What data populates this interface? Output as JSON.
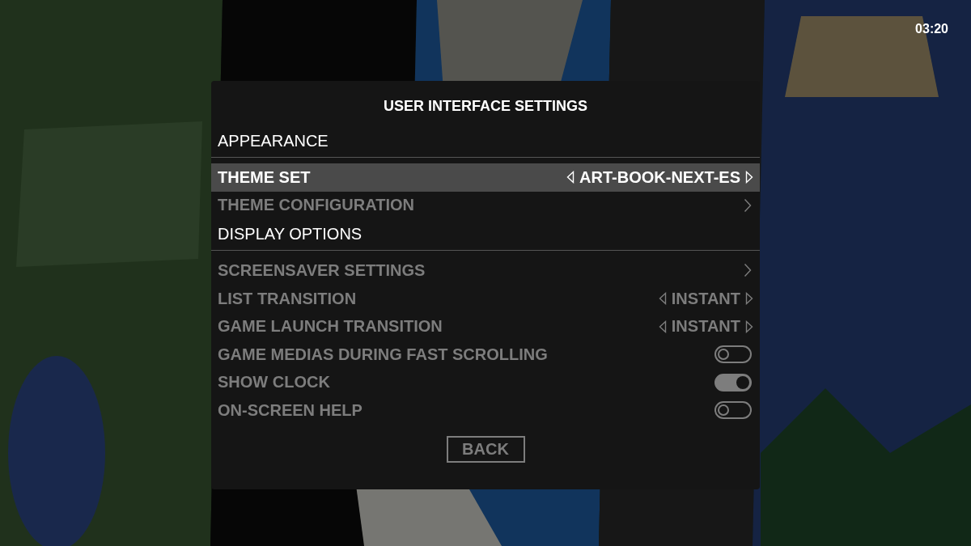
{
  "clock": "03:20",
  "dialog": {
    "title": "USER INTERFACE SETTINGS",
    "sections": [
      {
        "title": "APPEARANCE",
        "rows": [
          {
            "label": "THEME SET",
            "kind": "option",
            "value": "ART-BOOK-NEXT-ES",
            "selected": true
          },
          {
            "label": "THEME CONFIGURATION",
            "kind": "submenu",
            "selected": false
          }
        ]
      },
      {
        "title": "DISPLAY OPTIONS",
        "rows": [
          {
            "label": "SCREENSAVER SETTINGS",
            "kind": "submenu",
            "selected": false
          },
          {
            "label": "LIST TRANSITION",
            "kind": "option",
            "value": "INSTANT",
            "selected": false
          },
          {
            "label": "GAME LAUNCH TRANSITION",
            "kind": "option",
            "value": "INSTANT",
            "selected": false
          },
          {
            "label": "GAME MEDIAS DURING FAST SCROLLING",
            "kind": "toggle",
            "on": false,
            "selected": false
          },
          {
            "label": "SHOW CLOCK",
            "kind": "toggle",
            "on": true,
            "selected": false
          },
          {
            "label": "ON-SCREEN HELP",
            "kind": "toggle",
            "on": false,
            "selected": false
          }
        ]
      }
    ],
    "back_button": "BACK"
  }
}
